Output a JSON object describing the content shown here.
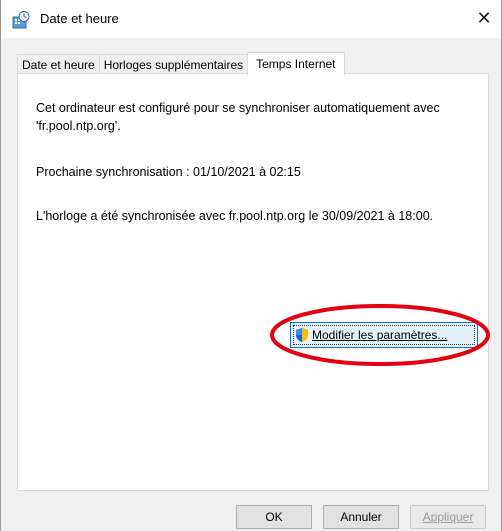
{
  "window": {
    "title": "Date et heure",
    "close_glyph": "✕",
    "icon": "date-time-app-icon"
  },
  "tabs": [
    {
      "label": "Date et heure",
      "active": false
    },
    {
      "label": "Horloges supplémentaires",
      "active": false
    },
    {
      "label": "Temps Internet",
      "active": true
    }
  ],
  "panel": {
    "description": "Cet ordinateur est configuré pour se synchroniser automatiquement avec\n'fr.pool.ntp.org'.",
    "next_sync": "Prochaine synchronisation : 01/10/2021 à 02:15",
    "last_sync": "L'horloge a été synchronisée avec fr.pool.ntp.org le 30/09/2021 à 18:00.",
    "modify_button": {
      "label": "Modifier les paramètres...",
      "icon": "uac-shield-icon"
    },
    "highlight_color": "#e3000f"
  },
  "buttons": {
    "ok": "OK",
    "cancel": "Annuler",
    "apply": "Appliquer",
    "apply_enabled": false
  }
}
